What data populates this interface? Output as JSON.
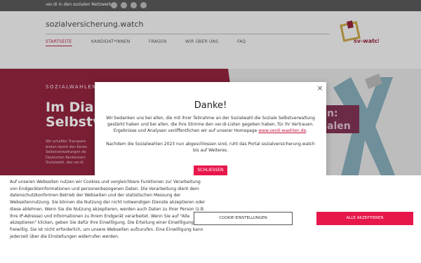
{
  "topbar": {
    "social_text": "ver.di in den sozialen Netzwerken",
    "icons": [
      "facebook-icon",
      "twitter-icon",
      "instagram-icon",
      "telegram-icon"
    ]
  },
  "header": {
    "site_title": "sozialversicherung.watch",
    "nav": [
      {
        "label": "STARTSEITE",
        "active": true
      },
      {
        "label": "KANDIDAT*INNEN",
        "active": false
      },
      {
        "label": "FRAGEN",
        "active": false
      },
      {
        "label": "WIR ÜBER UNS",
        "active": false
      },
      {
        "label": "FAQ",
        "active": false
      }
    ],
    "logo_text": "sv-watch"
  },
  "hero": {
    "kicker": "SOZIALWAHLEN",
    "title_line1": "Im Dialo",
    "title_line2": "Selbstve",
    "body_lines": [
      "Wir schaffen Transpare",
      "bieten damit den Konta",
      "Selbstverwaltungen de",
      "Deutschen Rentenvers",
      "Sozialwahl, das ver.di"
    ],
    "right_line1": "n:",
    "right_line2": "alen"
  },
  "modal": {
    "title": "Danke!",
    "para1": "Wir bedanken uns bei allen, die mit ihrer Teilnahme an der Sozialwahl die Soziale Selbstverwaltung gestärkt haben und bei allen, die ihre Stimme den ver.di-Listen gegeben haben, für ihr Vertrauen. Ergebnisse und Analysen veröffentlichen wir auf unserer Homepage",
    "link": "www.verdi-waehlen.de",
    "para1_end": ".",
    "para2": "Nachdem die Sozialwahlen 2023 nun abgeschlossen sind, ruht das Portal sozialversicherung.watch bis auf Weiteres.",
    "close_button": "SCHLIESSEN",
    "close_icon": "×"
  },
  "cookie": {
    "text": "Auf unseren Webseiten nutzen wir Cookies und vergleichbare Funktionen zur Verarbeitung von Endgeräteinformationen und personenbezogenen Daten. Die Verarbeitung dient dem datenschutzkonformen Betrieb der Webseiten und der statistischen Messung der Webseitennutzung. Sie können die Nutzung der nicht notwendigen Dienste akzeptieren oder diese ablehnen. Wenn Sie die Nutzung akzeptieren, werden auch Daten zu Ihrer Person (z.B. Ihre IP-Adresse) und Informationen zu Ihrem Endgerät verarbeitet. Wenn Sie auf \"Alle akzeptieren\" klicken, geben Sie dafür Ihre Einwilligung. Die Erteilung einer Einwilligung ist freiwillig. Sie ist nicht erforderlich, um unsere Webseiten aufzurufen. Eine Einwilligung kann jederzeit über die Einstellungen widerrufen werden.",
    "settings_button": "COOKIE-EINSTELLUNGEN",
    "accept_button": "ALLE AKZEPTIEREN"
  },
  "colors": {
    "accent": "#e8174b",
    "brand_dark": "#7a1e34",
    "topbar": "#4a4a4a"
  }
}
